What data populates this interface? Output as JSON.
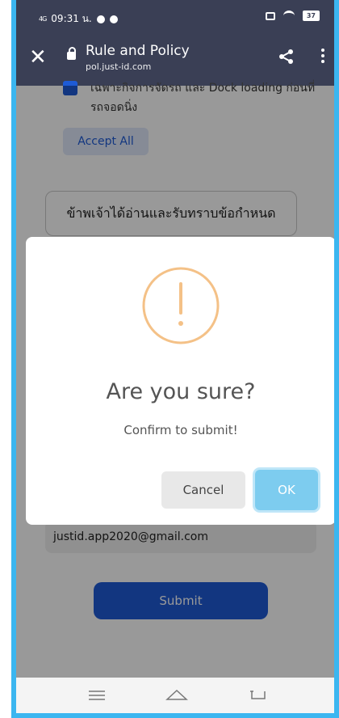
{
  "statusbar": {
    "network": "4G",
    "time": "09:31 น.",
    "battery": "37"
  },
  "browser": {
    "title": "Rule and Policy",
    "url": "pol.just-id.com"
  },
  "page": {
    "consent_line_1": "เฉพาะกิจการจัดรถ และ Dock loading ก่อนที่",
    "consent_line_2": "รถจอดนิ่ง",
    "accept_all_label": "Accept All",
    "acknowledge_text": "ข้าพเจ้าได้อ่านและรับทราบข้อกำหนด",
    "email_value": "justid.app2020@gmail.com",
    "submit_label": "Submit"
  },
  "dialog": {
    "icon": "warning-exclamation-icon",
    "title": "Are you sure?",
    "message": "Confirm to submit!",
    "cancel_label": "Cancel",
    "ok_label": "OK"
  },
  "colors": {
    "header": "#3a3f55",
    "primary": "#1e5bd6",
    "ok_button": "#7dccef",
    "warning": "#f4c187",
    "frame": "#3bb6f0"
  }
}
